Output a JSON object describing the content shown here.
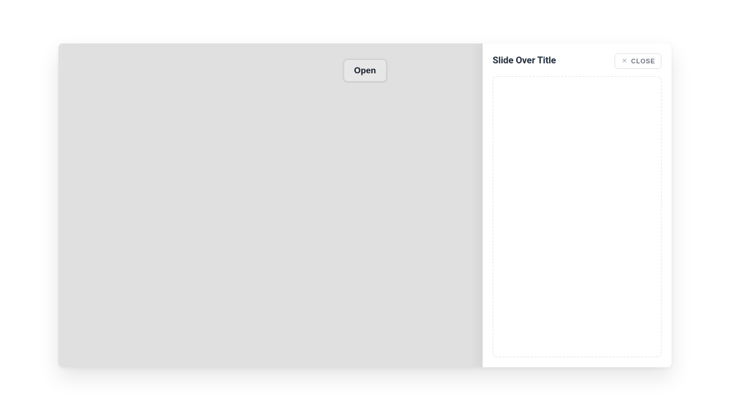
{
  "main": {
    "open_label": "Open"
  },
  "panel": {
    "title": "Slide Over Title",
    "close_label": "CLOSE"
  }
}
